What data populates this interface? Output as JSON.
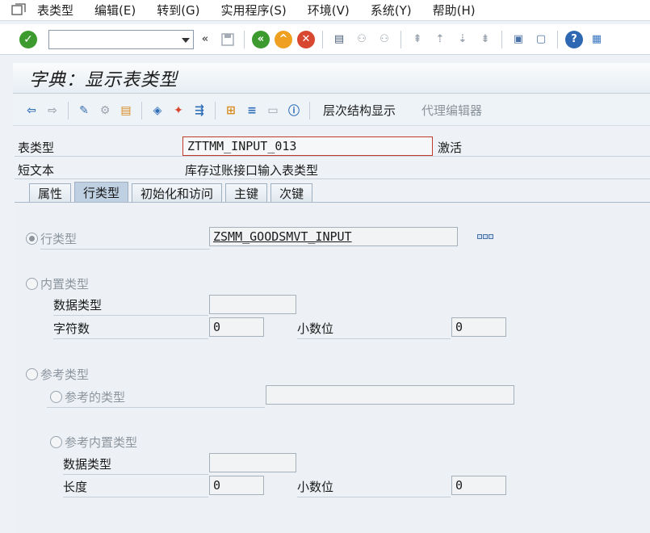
{
  "menu": [
    "表类型",
    "编辑(E)",
    "转到(G)",
    "实用程序(S)",
    "环境(V)",
    "系统(Y)",
    "帮助(H)"
  ],
  "command_field": {
    "value": ""
  },
  "title": "字典：显示表类型",
  "app_toolbar": {
    "hierarchy": "层次结构显示",
    "proxy_editor": "代理编辑器"
  },
  "header": {
    "table_type_label": "表类型",
    "table_type_value": "ZTTMM_INPUT_013",
    "status": "激活",
    "short_text_label": "短文本",
    "short_text_value": "库存过账接口输入表类型"
  },
  "tabs": [
    "属性",
    "行类型",
    "初始化和访问",
    "主键",
    "次键"
  ],
  "active_tab": "行类型",
  "content": {
    "row_type_label": "行类型",
    "row_type_value": "ZSMM_GOODSMVT_INPUT",
    "builtin_type_label": "内置类型",
    "data_type_label": "数据类型",
    "data_type_value": "",
    "char_count_label": "字符数",
    "char_count_value": "0",
    "decimals_label": "小数位",
    "decimals_value": "0",
    "ref_type_label": "参考类型",
    "ref_of_type_label": "参考的类型",
    "ref_of_type_value": "",
    "ref_builtin_label": "参考内置类型",
    "ref_data_type_label": "数据类型",
    "ref_data_type_value": "",
    "length_label": "长度",
    "length_value": "0",
    "ref_decimals_label": "小数位",
    "ref_decimals_value": "0"
  }
}
